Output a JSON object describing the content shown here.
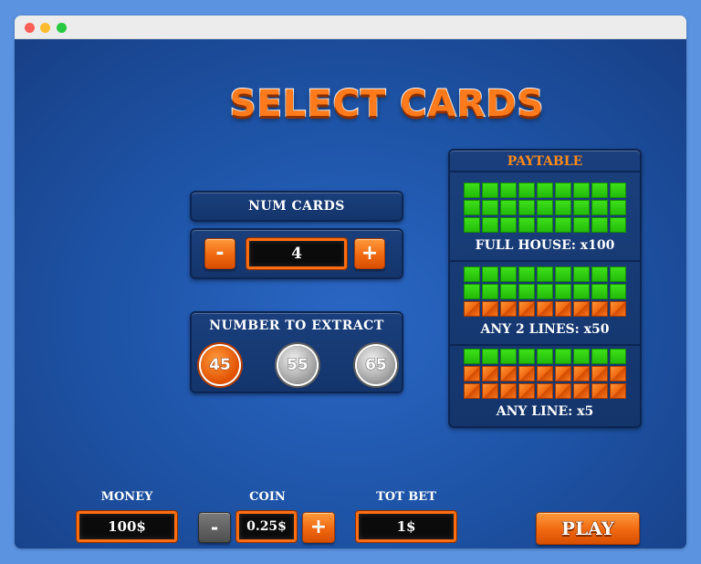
{
  "title": "SELECT CARDS",
  "num_cards": {
    "label": "NUM CARDS",
    "value": "4",
    "minus": "-",
    "plus": "+"
  },
  "extract": {
    "label": "NUMBER TO EXTRACT",
    "options": [
      "45",
      "55",
      "65"
    ],
    "selected": "45"
  },
  "paytable": {
    "title": "PAYTABLE",
    "entries": [
      {
        "label": "FULL HOUSE: x100",
        "rows": [
          "ggggggggg",
          "ggggggggg",
          "ggggggggg"
        ]
      },
      {
        "label": "ANY 2 LINES: x50",
        "rows": [
          "ggggggggg",
          "ggggggggg",
          "ooooooooo"
        ]
      },
      {
        "label": "ANY LINE: x5",
        "rows": [
          "ggggggggg",
          "ooooooooo",
          "ooooooooo"
        ]
      }
    ]
  },
  "bottom": {
    "money_label": "MONEY",
    "money_value": "100$",
    "coin_label": "COIN",
    "coin_value": "0.25$",
    "coin_minus": "-",
    "coin_plus": "+",
    "totbet_label": "TOT BET",
    "totbet_value": "1$",
    "play_label": "PLAY"
  },
  "colors": {
    "accent": "#f06810",
    "panel": "#14356c",
    "cell_green": "#2ecc12",
    "background": "#1d52a5"
  }
}
